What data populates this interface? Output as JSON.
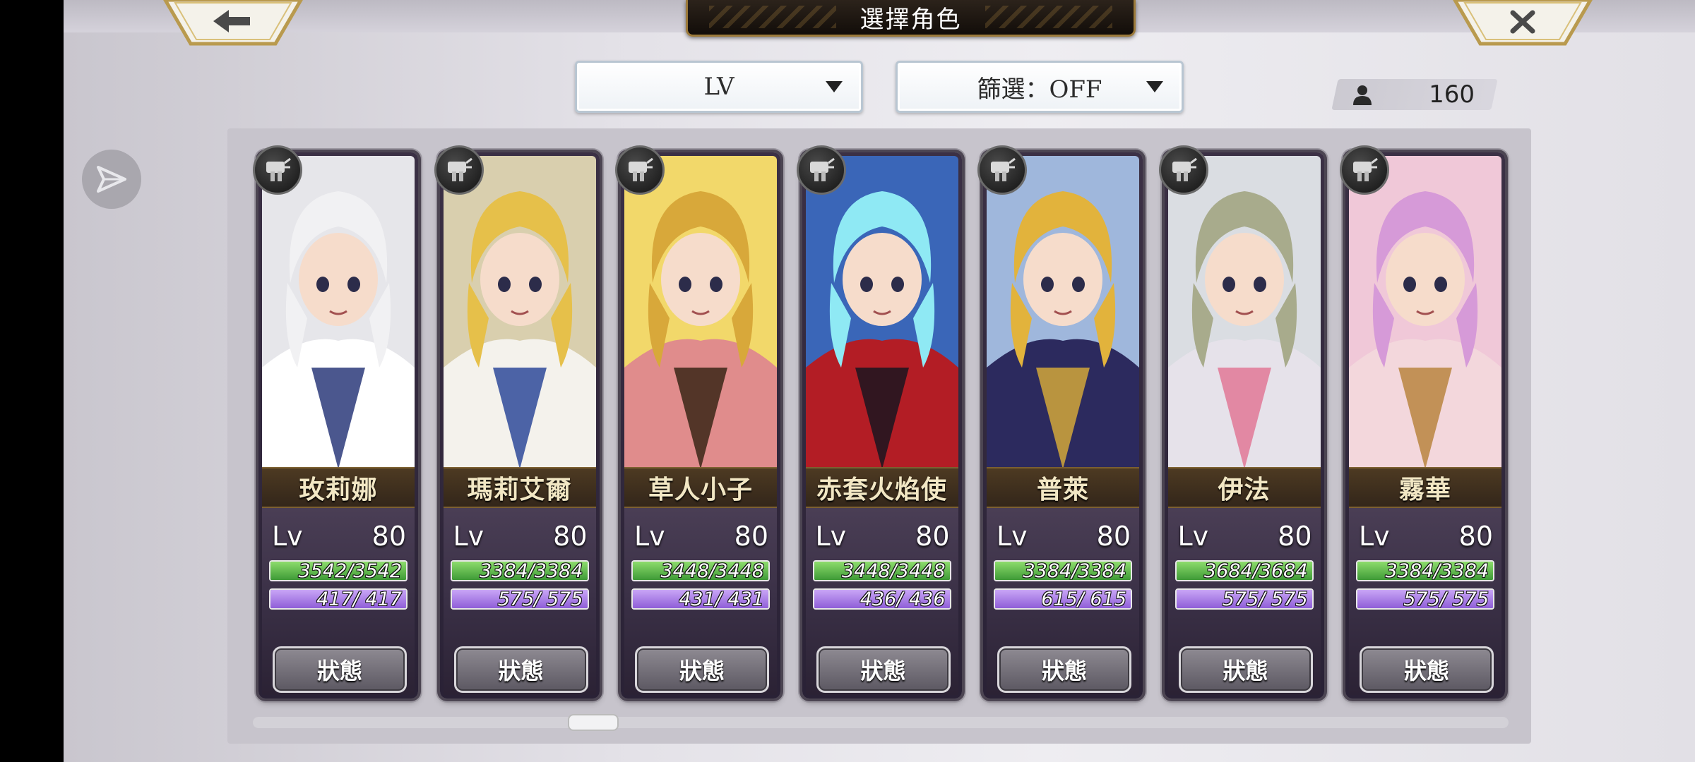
{
  "header": {
    "title": "選擇角色"
  },
  "nav": {
    "back_icon": "arrow-left-icon",
    "close_icon": "x-icon"
  },
  "sort": {
    "selected": "LV"
  },
  "filter": {
    "selected": "篩選：OFF"
  },
  "roster": {
    "count": "160",
    "icon": "user-icon"
  },
  "side": {
    "share_icon": "send-icon"
  },
  "colors": {
    "hp": "#5fbf4a",
    "mp": "#a57be6",
    "name_plate": "#3b2c1c",
    "card": "#34293f"
  },
  "scroll": {
    "position": 0.25
  },
  "characters": [
    {
      "name": "玫莉娜",
      "lv_label": "Lv",
      "level": "80",
      "hp": "3542/3542",
      "mp": "417/ 417",
      "status_label": "狀態",
      "hair": "#f1f1f3",
      "outfit": "#ffffff",
      "accent": "#2b3a7a",
      "bg": "#e6e6ea"
    },
    {
      "name": "瑪莉艾爾",
      "lv_label": "Lv",
      "level": "80",
      "hp": "3384/3384",
      "mp": "575/ 575",
      "status_label": "狀態",
      "hair": "#e6c04a",
      "outfit": "#f4f2ec",
      "accent": "#2e4a9a",
      "bg": "#d9cfae"
    },
    {
      "name": "草人小子",
      "lv_label": "Lv",
      "level": "80",
      "hp": "3448/3448",
      "mp": "431/ 431",
      "status_label": "狀態",
      "hair": "#d8a83a",
      "outfit": "#e08c8c",
      "accent": "#3a2616",
      "bg": "#f2d86a"
    },
    {
      "name": "赤套火焰使",
      "lv_label": "Lv",
      "level": "80",
      "hp": "3448/3448",
      "mp": "436/ 436",
      "status_label": "狀態",
      "hair": "#8fe9f4",
      "outfit": "#b31d25",
      "accent": "#1a1520",
      "bg": "#3a66b8"
    },
    {
      "name": "普萊",
      "lv_label": "Lv",
      "level": "80",
      "hp": "3384/3384",
      "mp": "615/ 615",
      "status_label": "狀態",
      "hair": "#e2b33c",
      "outfit": "#2c2a5e",
      "accent": "#d2a73a",
      "bg": "#9fb7dc"
    },
    {
      "name": "伊法",
      "lv_label": "Lv",
      "level": "80",
      "hp": "3684/3684",
      "mp": "575/ 575",
      "status_label": "狀態",
      "hair": "#a8ab8c",
      "outfit": "#e6e2ea",
      "accent": "#e07896",
      "bg": "#dadde2"
    },
    {
      "name": "霧華",
      "lv_label": "Lv",
      "level": "80",
      "hp": "3384/3384",
      "mp": "575/ 575",
      "status_label": "狀態",
      "hair": "#d69ad8",
      "outfit": "#f3d7dc",
      "accent": "#b88540",
      "bg": "#f0c8d8"
    }
  ]
}
